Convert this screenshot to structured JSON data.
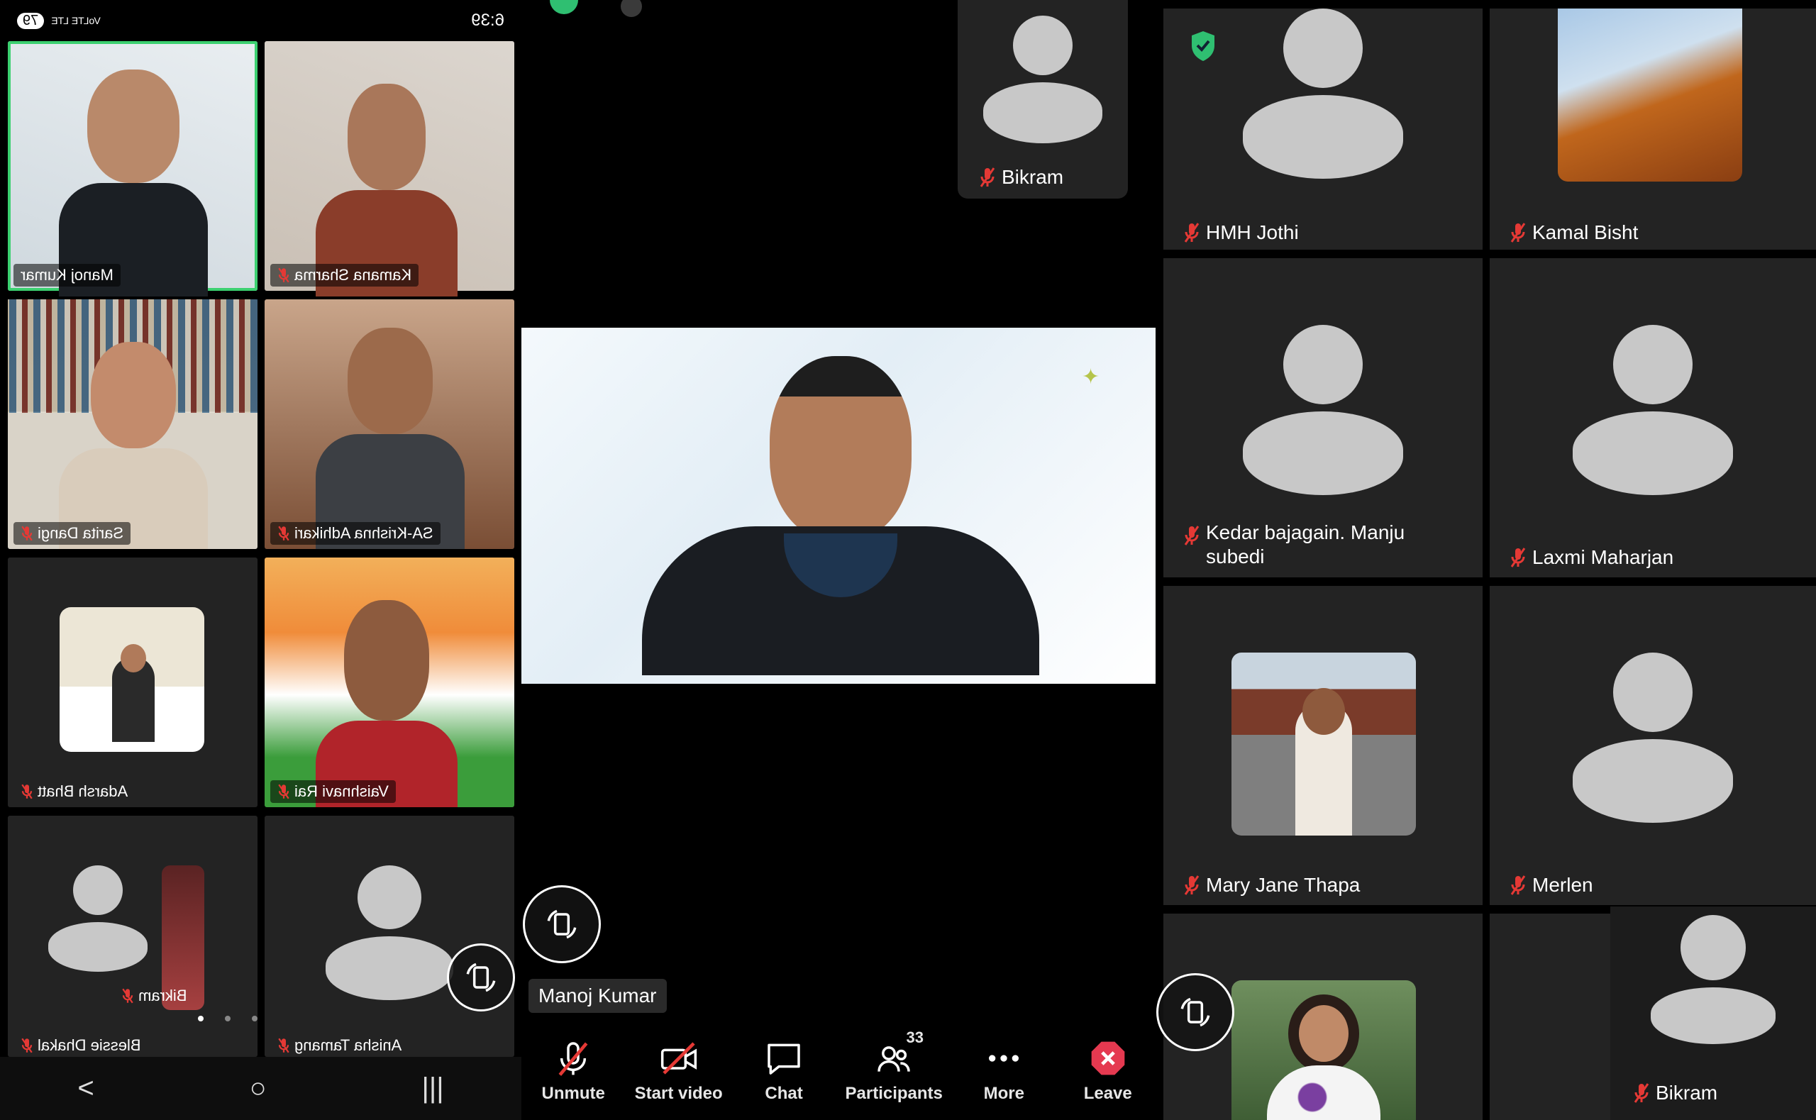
{
  "status_bar": {
    "time": "6:39",
    "battery": "79",
    "network": "VoLTE LTE"
  },
  "left_grid": {
    "tiles": [
      {
        "name": "Manoj Kumar",
        "muted": false
      },
      {
        "name": "Kamana Sharma",
        "muted": true
      },
      {
        "name": "Sarita Dangi",
        "muted": true
      },
      {
        "name": "SA-Krishna Adhikari",
        "muted": true
      },
      {
        "name": "Adarsh Bhatt",
        "muted": true
      },
      {
        "name": "Vaishnavi Rai",
        "muted": true
      },
      {
        "name": "Bikram",
        "muted": true
      },
      {
        "name": "Blessie Dhakal",
        "muted": true
      },
      {
        "name": "Anisha Tamang",
        "muted": true
      }
    ]
  },
  "nav_bar": {
    "back": ">",
    "home": "○",
    "recents": "|||"
  },
  "center": {
    "top_tile_name": "Bikram",
    "speaker_name": "Manoj Kumar"
  },
  "toolbar": {
    "unmute": "Unmute",
    "start_video": "Start video",
    "chat": "Chat",
    "participants": "Participants",
    "participants_count": "33",
    "more": "More",
    "leave": "Leave"
  },
  "right_grid": {
    "tiles": [
      {
        "name": "HMH Jothi"
      },
      {
        "name": "Kamal Bisht"
      },
      {
        "name": "Kedar bajagain. Manju subedi"
      },
      {
        "name": "Laxmi Maharjan"
      },
      {
        "name": "Mary Jane Thapa"
      },
      {
        "name": "Merlen"
      },
      {
        "name": "Bikram"
      }
    ]
  },
  "colors": {
    "muted_mic": "#e53935",
    "active_speaker": "#3cd070",
    "shield": "#2fbf71",
    "leave": "#e53950"
  }
}
